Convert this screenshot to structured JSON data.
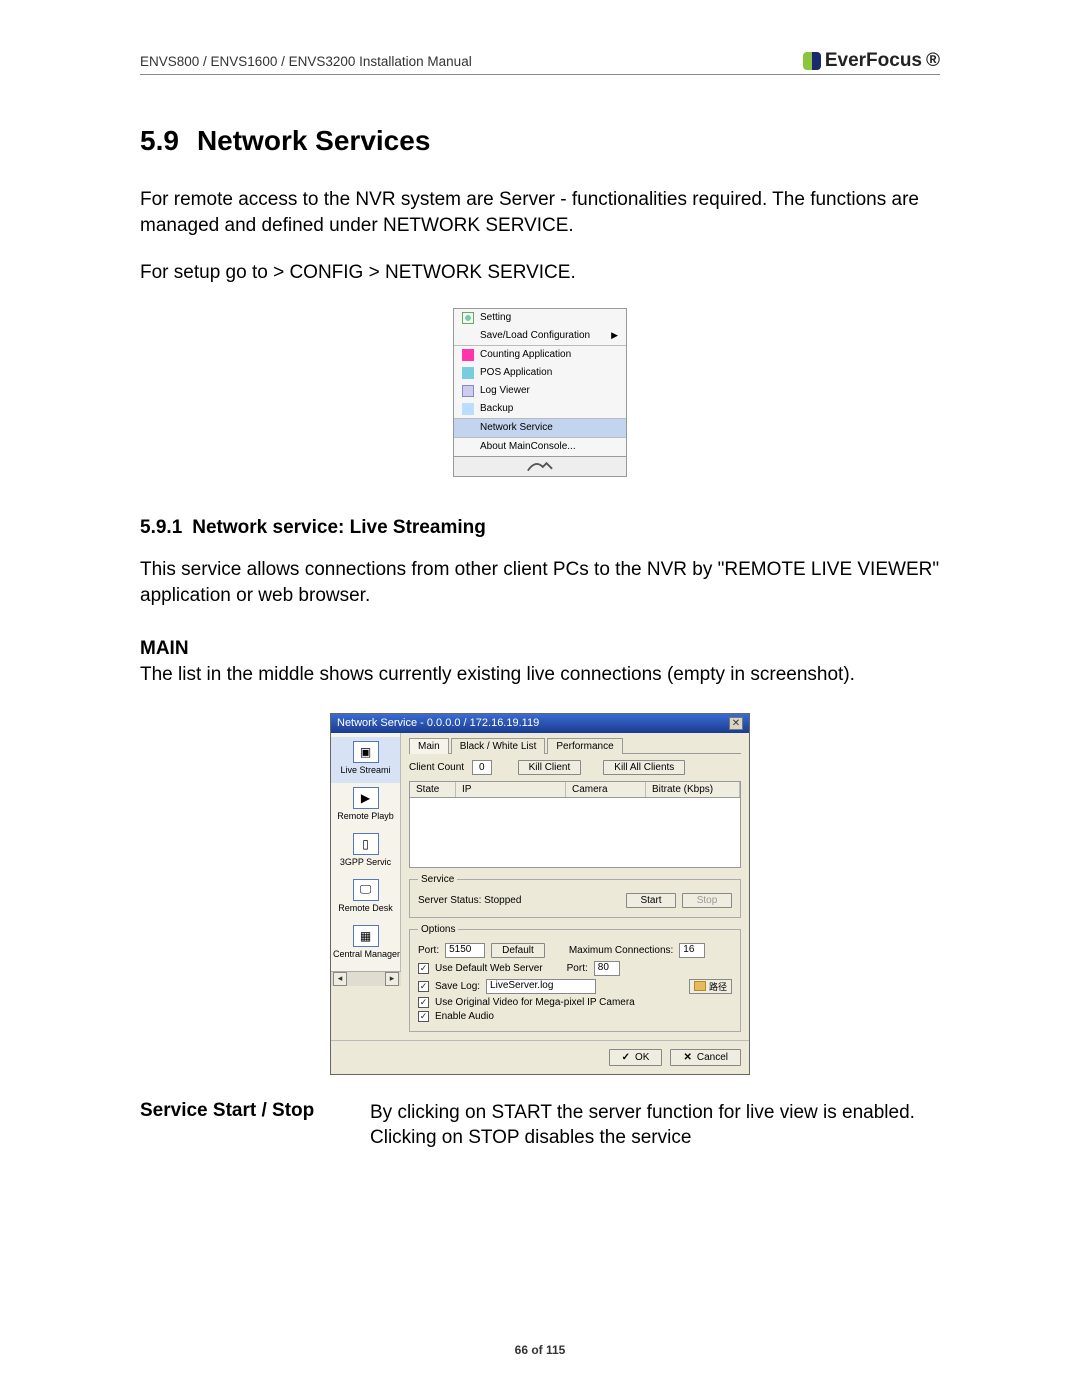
{
  "header": {
    "doc_title": "ENVS800 / ENVS1600 / ENVS3200 Installation Manual",
    "brand": "EverFocus"
  },
  "section": {
    "number": "5.9",
    "title": "Network Services"
  },
  "para1": "For remote access to the NVR system are Server - functionalities required. The functions are managed and defined under NETWORK SERVICE.",
  "para2": "For setup go to > CONFIG > NETWORK SERVICE.",
  "menu": {
    "items": [
      "Setting",
      "Save/Load Configuration",
      "Counting Application",
      "POS Application",
      "Log Viewer",
      "Backup",
      "Network Service",
      "About MainConsole..."
    ]
  },
  "subsection": {
    "number": "5.9.1",
    "title": "Network service: Live Streaming"
  },
  "para3": "This service allows connections from other client PCs to the NVR by \"REMOTE LIVE VIEWER\" application or web browser.",
  "main_label": "MAIN",
  "para4": "The list in the middle shows currently existing live connections (empty in screenshot).",
  "dialog": {
    "title": "Network Service - 0.0.0.0 / 172.16.19.119",
    "side": [
      "Live Streami",
      "Remote Playb",
      "3GPP Servic",
      "Remote Desk",
      "Central Managemen"
    ],
    "tabs": [
      "Main",
      "Black / White List",
      "Performance"
    ],
    "client_count_label": "Client Count",
    "client_count_value": "0",
    "kill_client": "Kill Client",
    "kill_all": "Kill All Clients",
    "cols": {
      "state": "State",
      "ip": "IP",
      "camera": "Camera",
      "bitrate": "Bitrate (Kbps)"
    },
    "service": {
      "legend": "Service",
      "status": "Server Status: Stopped",
      "start": "Start",
      "stop": "Stop"
    },
    "options": {
      "legend": "Options",
      "port_label": "Port:",
      "port_value": "5150",
      "default": "Default",
      "maxconn_label": "Maximum Connections:",
      "maxconn_value": "16",
      "use_default_web": "Use Default Web Server",
      "web_port_label": "Port:",
      "web_port_value": "80",
      "save_log": "Save Log:",
      "log_file": "LiveServer.log",
      "browse": "路径",
      "use_original": "Use Original Video for Mega-pixel IP Camera",
      "enable_audio": "Enable Audio"
    },
    "ok": "OK",
    "cancel": "Cancel"
  },
  "definition": {
    "term": "Service Start / Stop",
    "body_a": "By clicking on START the server function for live view is enabled.",
    "body_b": "Clicking on STOP disables the service"
  },
  "footer": "66 of 115"
}
